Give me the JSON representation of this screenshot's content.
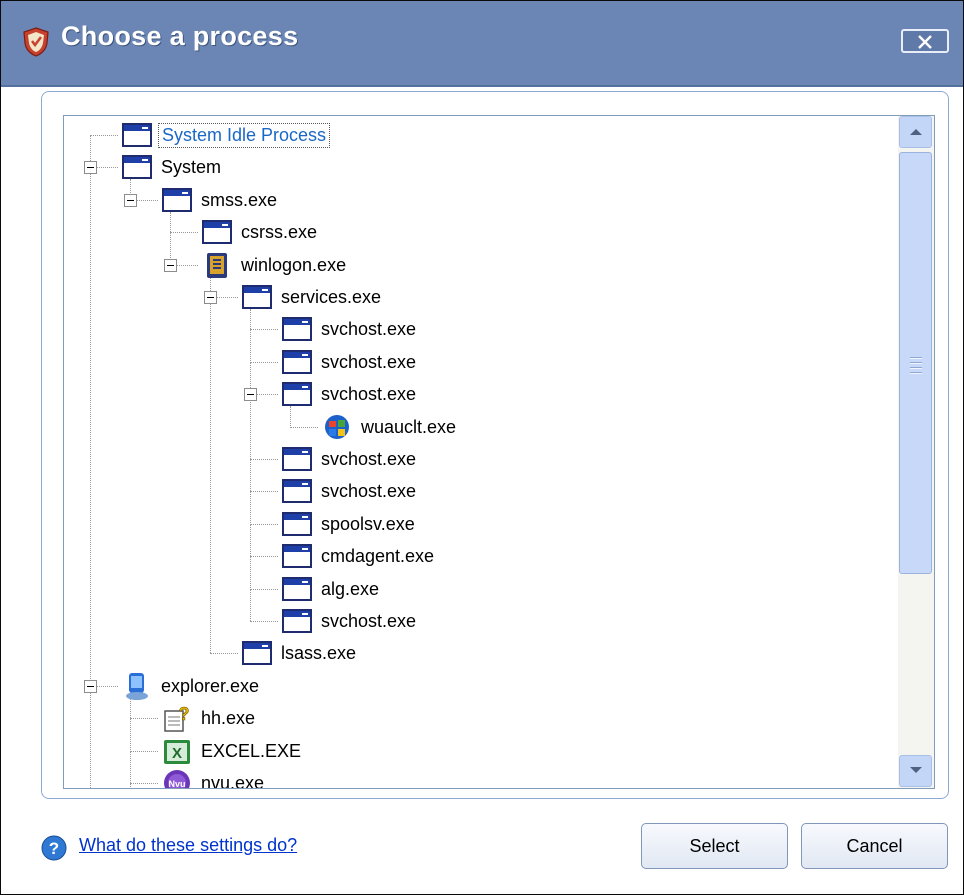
{
  "window": {
    "title": "Choose a process",
    "title_icon": "comodo-shield-icon",
    "close_icon": "close-x-icon"
  },
  "tree": {
    "nodes": [
      {
        "id": "n0",
        "label": "System Idle Process",
        "icon": "window-app-icon",
        "selected": true
      },
      {
        "id": "n1",
        "label": "System",
        "icon": "window-app-icon"
      },
      {
        "id": "n2",
        "label": "smss.exe",
        "icon": "window-app-icon"
      },
      {
        "id": "n3",
        "label": "csrss.exe",
        "icon": "window-app-icon"
      },
      {
        "id": "n4",
        "label": "winlogon.exe",
        "icon": "winlogon-icon"
      },
      {
        "id": "n5",
        "label": "services.exe",
        "icon": "window-app-icon"
      },
      {
        "id": "n6",
        "label": "svchost.exe",
        "icon": "window-app-icon"
      },
      {
        "id": "n7",
        "label": "svchost.exe",
        "icon": "window-app-icon"
      },
      {
        "id": "n8",
        "label": "svchost.exe",
        "icon": "window-app-icon"
      },
      {
        "id": "n9",
        "label": "wuauclt.exe",
        "icon": "windows-update-icon"
      },
      {
        "id": "n10",
        "label": "svchost.exe",
        "icon": "window-app-icon"
      },
      {
        "id": "n11",
        "label": "svchost.exe",
        "icon": "window-app-icon"
      },
      {
        "id": "n12",
        "label": "spoolsv.exe",
        "icon": "window-app-icon"
      },
      {
        "id": "n13",
        "label": "cmdagent.exe",
        "icon": "window-app-icon"
      },
      {
        "id": "n14",
        "label": "alg.exe",
        "icon": "window-app-icon"
      },
      {
        "id": "n15",
        "label": "svchost.exe",
        "icon": "window-app-icon"
      },
      {
        "id": "n16",
        "label": "lsass.exe",
        "icon": "window-app-icon"
      },
      {
        "id": "n17",
        "label": "explorer.exe",
        "icon": "explorer-icon"
      },
      {
        "id": "n18",
        "label": "hh.exe",
        "icon": "help-file-icon"
      },
      {
        "id": "n19",
        "label": "EXCEL.EXE",
        "icon": "excel-icon"
      },
      {
        "id": "n20",
        "label": "nvu.exe",
        "icon": "nvu-icon"
      }
    ]
  },
  "footer": {
    "help_link": "What do these settings do?",
    "select_label": "Select",
    "cancel_label": "Cancel"
  },
  "colors": {
    "titlebar": "#6b86b4",
    "selected_text": "#1a67c6",
    "link": "#0033cc"
  }
}
